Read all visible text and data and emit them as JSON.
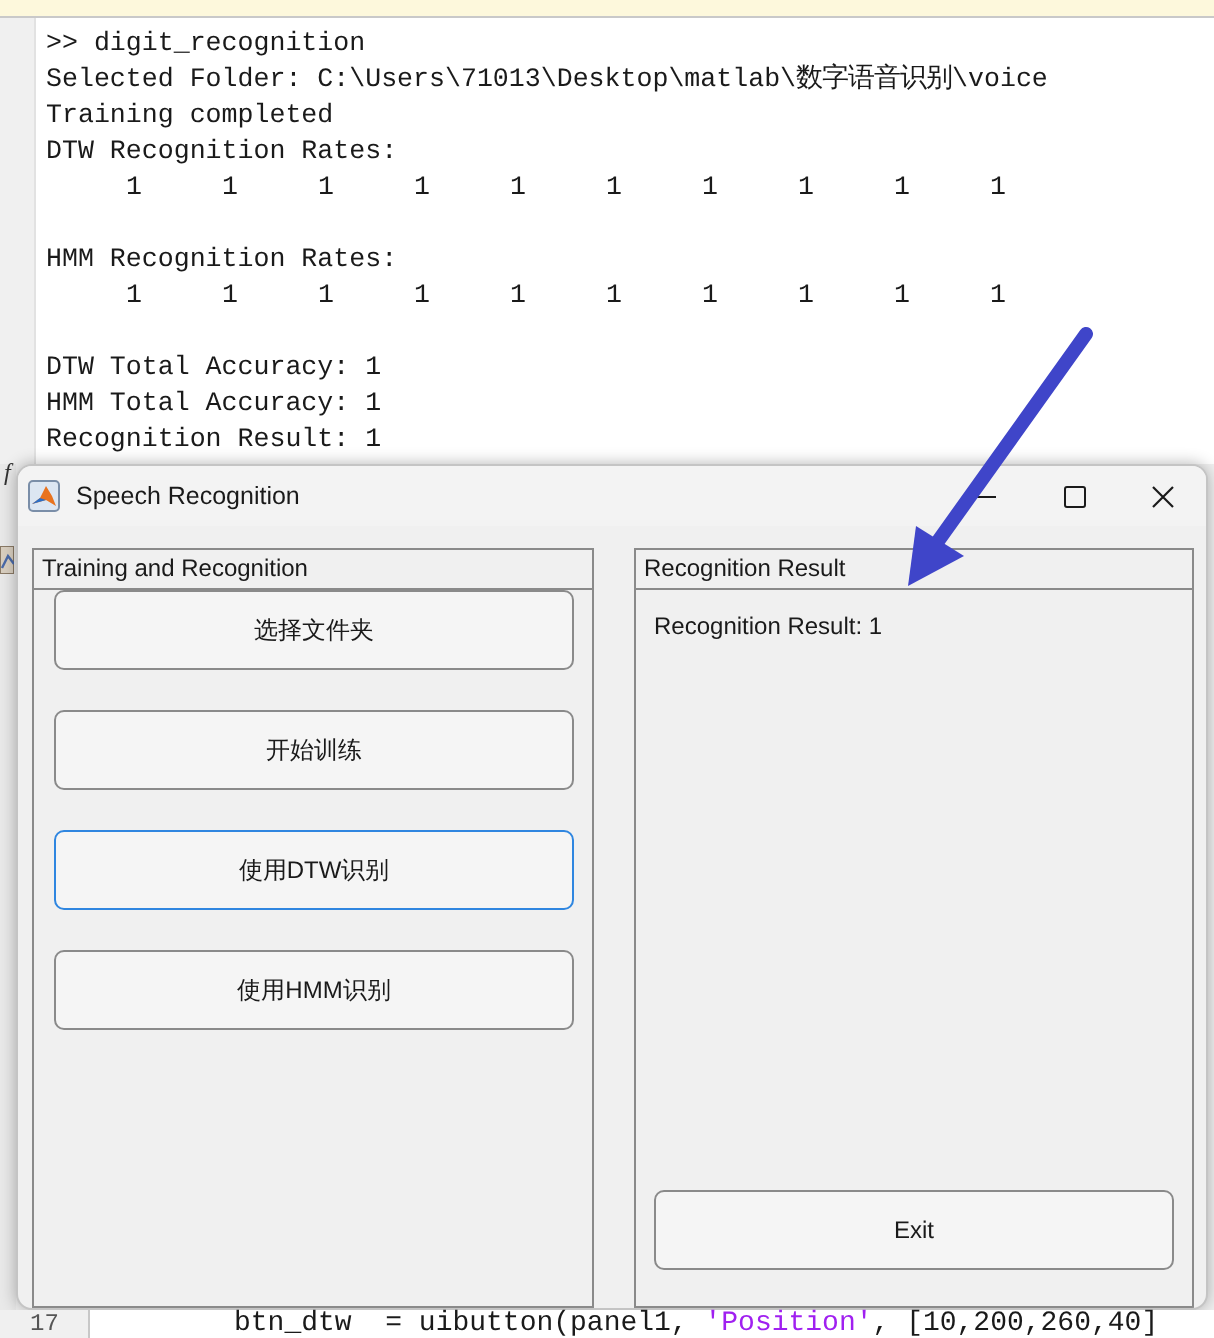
{
  "command_window": {
    "function_button": "f",
    "lines": [
      {
        "kind": "command",
        "text": ">> digit_recognition"
      },
      {
        "kind": "output",
        "text": "Selected Folder: C:\\Users\\71013\\Desktop\\matlab\\数字语音识别\\voice"
      },
      {
        "kind": "output",
        "text": "Training completed"
      },
      {
        "kind": "output",
        "text": "DTW Recognition Rates:"
      },
      {
        "kind": "values",
        "values": [
          "1",
          "1",
          "1",
          "1",
          "1",
          "1",
          "1",
          "1",
          "1",
          "1"
        ]
      },
      {
        "kind": "output",
        "text": "HMM Recognition Rates:"
      },
      {
        "kind": "values",
        "values": [
          "1",
          "1",
          "1",
          "1",
          "1",
          "1",
          "1",
          "1",
          "1",
          "1"
        ]
      },
      {
        "kind": "output",
        "text": "DTW Total Accuracy: 1"
      },
      {
        "kind": "output",
        "text": "HMM Total Accuracy: 1"
      },
      {
        "kind": "output",
        "text": "Recognition Result: 1"
      }
    ]
  },
  "dialog": {
    "title": "Speech Recognition",
    "panels": [
      {
        "kind": "buttons",
        "title": "Training and Recognition",
        "buttons": [
          {
            "label": "选择文件夹",
            "focused": false
          },
          {
            "label": "开始训练",
            "focused": false
          },
          {
            "label": "使用DTW识别",
            "focused": true
          },
          {
            "label": "使用HMM识别",
            "focused": false
          }
        ]
      },
      {
        "kind": "result",
        "title": "Recognition Result",
        "result_label": "Recognition Result: 1",
        "buttons": [
          {
            "label": "Exit",
            "focused": false
          }
        ]
      }
    ]
  },
  "editor": {
    "line_number": "17",
    "code": [
      {
        "kind": "code",
        "text": "btn_dtw  = uibutton(panel1, "
      },
      {
        "kind": "string",
        "text": "'Position'"
      },
      {
        "kind": "code",
        "text": ", [10,200,260,40]"
      }
    ]
  },
  "annotations": [
    {
      "kind": "arrow"
    }
  ]
}
